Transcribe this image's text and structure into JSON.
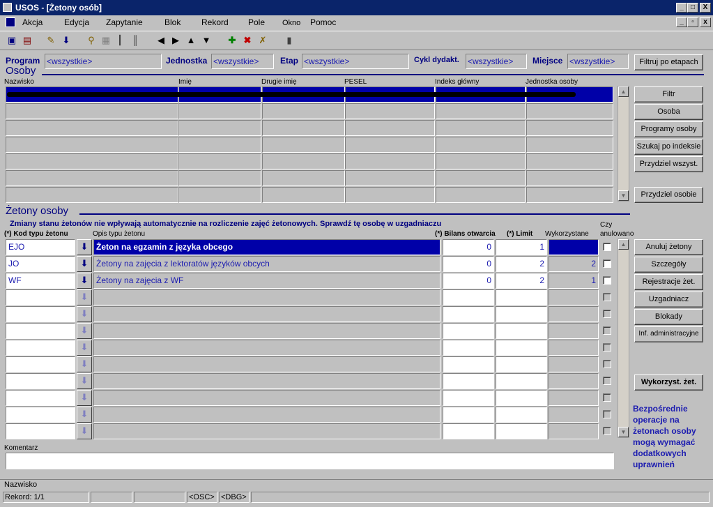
{
  "window": {
    "title": "USOS - [Żetony osób]",
    "min": "_",
    "max": "□",
    "close": "X"
  },
  "menu": [
    "Akcja",
    "Edycja",
    "Zapytanie",
    "Blok",
    "Rekord",
    "Pole",
    "Okno",
    "Pomoc"
  ],
  "filters": {
    "program_label": "Program",
    "program_value": "<wszystkie>",
    "jednostka_label": "Jednostka",
    "jednostka_value": "<wszystkie>",
    "etap_label": "Etap",
    "etap_value": "<wszystkie>",
    "cykl_label": "Cykl dydakt.",
    "cykl_value": "<wszystkie>",
    "miejsce_label": "Miejsce",
    "miejsce_value": "<wszystkie>",
    "filter_button": "Filtruj po etapach"
  },
  "osoby": {
    "title": "Osoby",
    "columns": [
      "Nazwisko",
      "Imię",
      "Drugie imię",
      "PESEL",
      "Indeks główny",
      "Jednostka osoby"
    ],
    "buttons": [
      "Filtr",
      "Osoba",
      "Programy osoby",
      "Szukaj po indeksie",
      "Przydziel wszyst.",
      "Przydziel osobie"
    ]
  },
  "zetony": {
    "title": "Żetony osoby",
    "warning": "Zmiany stanu żetonów nie wpływają automatycznie na rozliczenie zajęć żetonowych. Sprawdź tę osobę w uzgadniaczu",
    "col_kod": "(*) Kod typu żetonu",
    "col_opis": "Opis typu żetonu",
    "col_bilans": "(*) Bilans otwarcia",
    "col_limit": "(*) Limit",
    "col_wyk": "Wykorzystane",
    "col_czy1": "Czy",
    "col_czy2": "anulowano",
    "rows": [
      {
        "kod": "EJO",
        "opis": "Żeton na egzamin z języka obcego",
        "bilans": "0",
        "limit": "1",
        "wyk": ""
      },
      {
        "kod": "JO",
        "opis": "Żetony na zajęcia z lektoratów języków obcych",
        "bilans": "0",
        "limit": "2",
        "wyk": "2"
      },
      {
        "kod": "WF",
        "opis": "Żetony na zajęcia z WF",
        "bilans": "0",
        "limit": "2",
        "wyk": "1"
      }
    ],
    "buttons": [
      "Anuluj żetony",
      "Szczegóły",
      "Rejestracje żet.",
      "Uzgadniacz",
      "Blokady",
      "Inf. administracyjne"
    ],
    "wyk_button": "Wykorzyst. żet.",
    "note": "Bezpośrednie operacje na żetonach osoby mogą wymagać dodatkowych uprawnień",
    "komentarz_label": "Komentarz"
  },
  "status": {
    "field": "Nazwisko",
    "record": "Rekord: 1/1",
    "osc": "<OSC>",
    "dbg": "<DBG>"
  }
}
